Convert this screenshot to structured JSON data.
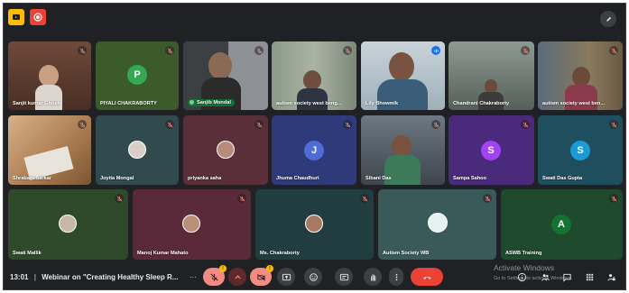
{
  "meeting": {
    "time": "13:01",
    "separator": "|",
    "title": "Webinar on \"Creating Healthy Sleep R..."
  },
  "participants": [
    {
      "id": "p1",
      "name": "Sanjit kumar Ghosh",
      "type": "video",
      "muted": true
    },
    {
      "id": "p2",
      "name": "PIYALI CHAKRABORTY",
      "type": "avatar",
      "initial": "P",
      "avatar_color": "#34a853",
      "muted": true
    },
    {
      "id": "p3",
      "name": "Sanjib Mondal",
      "type": "video",
      "muted": true,
      "pinned_pill": true
    },
    {
      "id": "p4",
      "name": "autism society west beng...",
      "type": "video",
      "muted": true
    },
    {
      "id": "p5",
      "name": "Lily Bhowmik",
      "type": "video",
      "speaking": true
    },
    {
      "id": "p6",
      "name": "Chandrani Chakraborty",
      "type": "video",
      "muted": true
    },
    {
      "id": "p7",
      "name": "autism society west ben...",
      "type": "video",
      "muted": true
    },
    {
      "id": "p8",
      "name": "Shrabani Sarkar",
      "type": "video",
      "muted": true
    },
    {
      "id": "p9",
      "name": "Joyita Mongal",
      "type": "photo",
      "muted": true
    },
    {
      "id": "p10",
      "name": "priyanka saha",
      "type": "photo",
      "muted": true
    },
    {
      "id": "p11",
      "name": "Jhuma Chaudhuri",
      "type": "avatar",
      "initial": "J",
      "avatar_color": "#4f6bd5",
      "muted": true
    },
    {
      "id": "p12",
      "name": "Sibani Das",
      "type": "video",
      "muted": true
    },
    {
      "id": "p13",
      "name": "Sampa Sahoo",
      "type": "avatar",
      "initial": "S",
      "avatar_color": "#a142f4",
      "muted": true
    },
    {
      "id": "p14",
      "name": "Swati Das Gupta",
      "type": "avatar",
      "initial": "S",
      "avatar_color": "#1a9bd7",
      "muted": true
    },
    {
      "id": "p15",
      "name": "Swati Mallik",
      "type": "photo",
      "muted": true
    },
    {
      "id": "p16",
      "name": "Manoj Kumar Mahato",
      "type": "photo",
      "muted": true
    },
    {
      "id": "p17",
      "name": "Ms. Chakraborty",
      "type": "photo",
      "muted": true
    },
    {
      "id": "p18",
      "name": "Autism Society WB",
      "type": "photo",
      "muted": true
    },
    {
      "id": "p19",
      "name": "ASWB Training",
      "type": "avatar",
      "initial": "A",
      "avatar_color": "#137333",
      "muted": true
    }
  ],
  "controls": {
    "more_label": "···",
    "mic_badge": "!",
    "cam_badge": "!"
  },
  "watermark": {
    "line1": "Activate Windows",
    "line2": "Go to Settings to activate Windows."
  },
  "colors": {
    "background": "#202124",
    "tile_dark": "#3c4043",
    "speaking_blue": "#8ab4f8",
    "end_call_red": "#ea4335",
    "mute_red": "#f28b82"
  }
}
